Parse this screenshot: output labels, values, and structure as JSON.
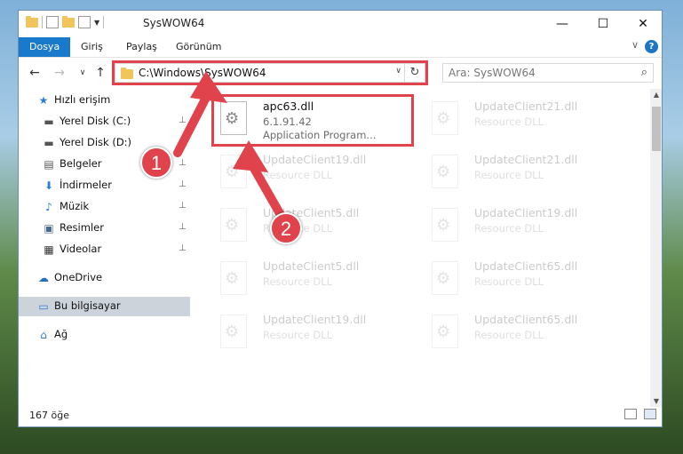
{
  "window": {
    "title": "SysWOW64",
    "controls": {
      "minimize": "—",
      "maximize": "☐",
      "close": "✕"
    }
  },
  "ribbon": {
    "tabs": [
      "Dosya",
      "Giriş",
      "Paylaş",
      "Görünüm"
    ],
    "expand": "∨",
    "help": "?"
  },
  "nav": {
    "back": "←",
    "forward": "→",
    "recent": "∨",
    "up": "↑",
    "address": "C:\\Windows\\SysWOW64",
    "address_dropdown": "∨",
    "refresh": "↻",
    "search_placeholder": "Ara: SysWOW64",
    "search_icon": "⌕"
  },
  "sidebar": {
    "items": [
      {
        "label": "Hızlı erişim",
        "icon": "star-icon",
        "glyph": "★",
        "color": "#2b7cd3"
      },
      {
        "label": "Yerel Disk (C:)",
        "icon": "drive-icon",
        "glyph": "▬",
        "color": "#555",
        "pin": true
      },
      {
        "label": "Yerel Disk (D:)",
        "icon": "drive-icon",
        "glyph": "▬",
        "color": "#555",
        "pin": true
      },
      {
        "label": "Belgeler",
        "icon": "documents-icon",
        "glyph": "▤",
        "color": "#555",
        "pin": true
      },
      {
        "label": "İndirmeler",
        "icon": "download-icon",
        "glyph": "⬇",
        "color": "#2b7cd3",
        "pin": true
      },
      {
        "label": "Müzik",
        "icon": "music-icon",
        "glyph": "♪",
        "color": "#2b7cd3",
        "pin": true
      },
      {
        "label": "Resimler",
        "icon": "pictures-icon",
        "glyph": "▣",
        "color": "#4a6a8a",
        "pin": true
      },
      {
        "label": "Videolar",
        "icon": "videos-icon",
        "glyph": "▦",
        "color": "#333",
        "pin": true
      },
      {
        "label": "OneDrive",
        "icon": "cloud-icon",
        "glyph": "☁",
        "color": "#1e6fc6"
      },
      {
        "label": "Bu bilgisayar",
        "icon": "computer-icon",
        "glyph": "▭",
        "color": "#2b7cd3",
        "selected": true
      },
      {
        "label": "Ağ",
        "icon": "network-icon",
        "glyph": "⌂",
        "color": "#2b7cd3"
      }
    ],
    "pin_glyph": "📌"
  },
  "files": [
    {
      "name": "apc63.dll",
      "line2": "6.1.91.42",
      "line3": "Application Program...",
      "ghost": false
    },
    {
      "name": "UpdateClient21.dll",
      "line2": "Resource DLL",
      "ghost": true
    },
    {
      "name": "UpdateClient19.dll",
      "line2": "Resource DLL",
      "ghost": true
    },
    {
      "name": "UpdateClient21.dll",
      "line2": "Resource DLL",
      "ghost": true
    },
    {
      "name": "UpdateClient5.dll",
      "line2": "Resource DLL",
      "ghost": true
    },
    {
      "name": "UpdateClient19.dll",
      "line2": "Resource DLL",
      "ghost": true
    },
    {
      "name": "UpdateClient5.dll",
      "line2": "Resource DLL",
      "ghost": true
    },
    {
      "name": "UpdateClient65.dll",
      "line2": "Resource DLL",
      "ghost": true
    },
    {
      "name": "UpdateClient19.dll",
      "line2": "Resource DLL",
      "ghost": true
    },
    {
      "name": "UpdateClient65.dll",
      "line2": "Resource DLL",
      "ghost": true
    }
  ],
  "status": {
    "count": "167 öğe"
  },
  "callouts": [
    "1",
    "2"
  ],
  "colors": {
    "accent": "#1979ca",
    "highlight": "#e0434c"
  }
}
